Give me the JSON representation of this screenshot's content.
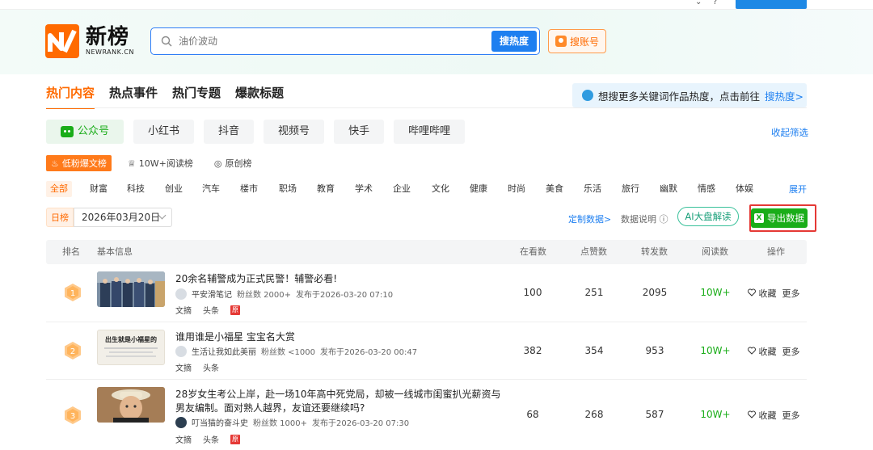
{
  "logo": {
    "cn": "新榜",
    "en": "NEWRANK.CN"
  },
  "search": {
    "placeholder": "油价波动",
    "button": "搜热度",
    "account_button": "搜账号"
  },
  "main_tabs": [
    "热门内容",
    "热点事件",
    "热门专题",
    "爆款标题"
  ],
  "hint": {
    "text": "想搜更多关键词作品热度，点击前往",
    "link": "搜热度>"
  },
  "platforms": [
    "公众号",
    "小红书",
    "抖音",
    "视频号",
    "快手",
    "哔哩哔哩"
  ],
  "collapse_label": "收起筛选",
  "sub_tabs": [
    "低粉爆文榜",
    "10W+阅读榜",
    "原创榜"
  ],
  "categories": [
    "全部",
    "财富",
    "科技",
    "创业",
    "汽车",
    "楼市",
    "职场",
    "教育",
    "学术",
    "企业",
    "文化",
    "健康",
    "时尚",
    "美食",
    "乐活",
    "旅行",
    "幽默",
    "情感",
    "体娱"
  ],
  "expand_label": "展开",
  "date": {
    "tag": "日榜",
    "value": "2026年03月20日"
  },
  "toolbar": {
    "custom": "定制数据>",
    "explain": "数据说明",
    "ai": "AI大盘解读",
    "export": "导出数据"
  },
  "table": {
    "headers": [
      "排名",
      "基本信息",
      "在看数",
      "点赞数",
      "转发数",
      "阅读数",
      "操作"
    ],
    "rows": [
      {
        "rank": "1",
        "title": "20余名辅警成为正式民警！辅警必看!",
        "author": "平安滑笔记",
        "fans": "粉丝数 2000+",
        "published": "发布于2026-03-20 07:10",
        "tag1": "文摘",
        "tag2": "头条",
        "watching": "100",
        "likes": "251",
        "shares": "2095",
        "reads": "10W+",
        "fav": "收藏",
        "more": "更多"
      },
      {
        "rank": "2",
        "title": "谁用谁是小福星 宝宝名大赏",
        "author": "生活让我如此美丽",
        "fans": "粉丝数 <1000",
        "published": "发布于2026-03-20 00:47",
        "tag1": "文摘",
        "tag2": "头条",
        "thumb_text": "出生就是小福星的",
        "watching": "382",
        "likes": "354",
        "shares": "953",
        "reads": "10W+",
        "fav": "收藏",
        "more": "更多"
      },
      {
        "rank": "3",
        "title": "28岁女生考公上岸，赴一场10年高中死党局，却被一线城市闺蜜扒光薪资与男友编制。面对熟人越界，友谊还要继续吗?",
        "author": "叮当猫的奋斗史",
        "fans": "粉丝数 1000+",
        "published": "发布于2026-03-20 07:30",
        "tag1": "文摘",
        "tag2": "头条",
        "watching": "68",
        "likes": "268",
        "shares": "587",
        "reads": "10W+",
        "fav": "收藏",
        "more": "更多"
      }
    ],
    "original_badge": "原"
  },
  "colors": {
    "accent": "#ff6a00",
    "primary": "#1e7ff0",
    "green": "#1aad19",
    "highlight": "#e53935"
  }
}
